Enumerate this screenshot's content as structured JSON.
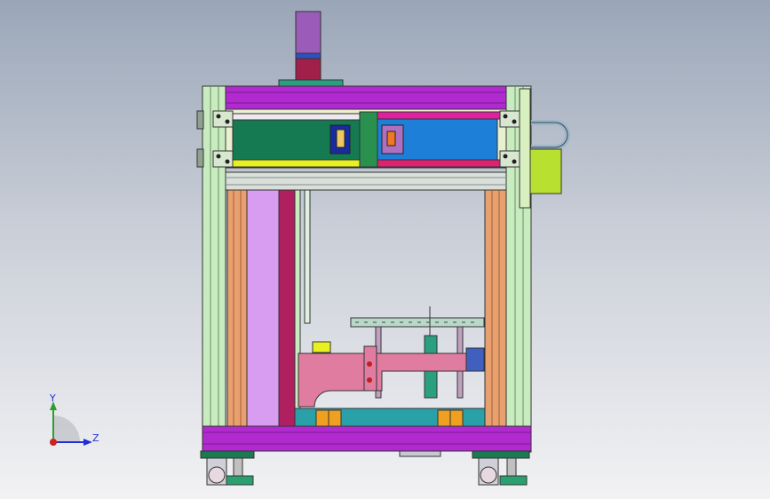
{
  "viewport": {
    "background_top": "#9aa6b8",
    "background_bottom": "#f2f2f4"
  },
  "triad": {
    "y_label": "Y",
    "z_label": "Z",
    "y_color": "#2e9e2e",
    "z_color": "#2030d0",
    "x_color": "#d02020"
  },
  "colors": {
    "frame_green": "#c8ecc0",
    "beam_purple": "#b02ad0",
    "beam_pink": "#e020c8",
    "panel_green": "#157a52",
    "panel_blue": "#1e7fd8",
    "yellow": "#e8f020",
    "orange_post": "#e8a070",
    "lilac": "#d89cf0",
    "gantry_pink": "#e07ca0",
    "teal": "#2aa0a8",
    "orange_block": "#f0a020",
    "motor_purple": "#9a5cb8",
    "motor_red": "#a0204a",
    "lime_box": "#b8e030"
  }
}
